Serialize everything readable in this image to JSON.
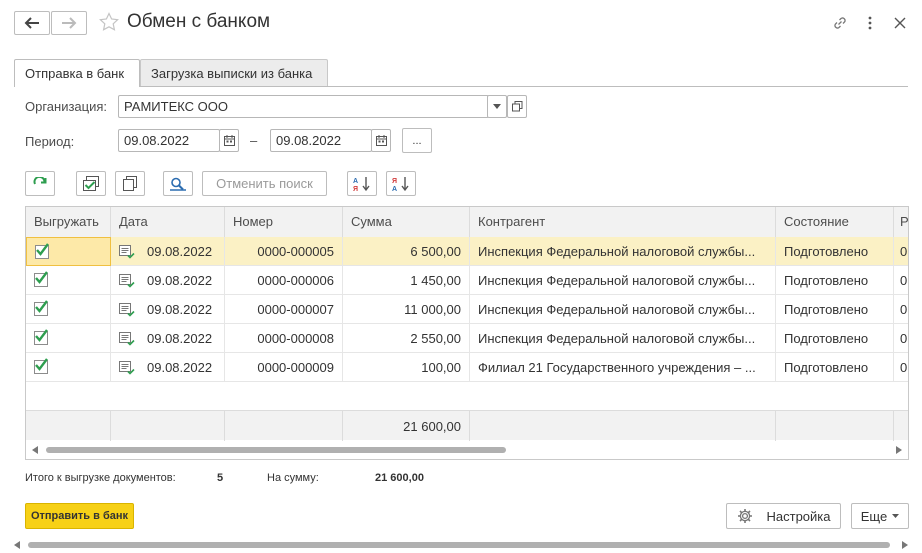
{
  "window": {
    "title": "Обмен с банком"
  },
  "tabs": [
    {
      "label": "Отправка в банк"
    },
    {
      "label": "Загрузка выписки из банка"
    }
  ],
  "form": {
    "org_label": "Организация:",
    "org_value": "РАМИТЕКС ООО",
    "period_label": "Период:",
    "period_from": "09.08.2022",
    "period_dash": "–",
    "period_to": "09.08.2022",
    "period_more": "..."
  },
  "toolbar": {
    "cancel_search": "Отменить поиск"
  },
  "table": {
    "headers": [
      "Выгружать",
      "Дата",
      "Номер",
      "Сумма",
      "Контрагент",
      "Состояние",
      "Р"
    ],
    "rows": [
      {
        "date": "09.08.2022",
        "number": "0000-000005",
        "sum": "6 500,00",
        "contractor": "Инспекция Федеральной налоговой службы...",
        "state": "Подготовлено",
        "extra": "0"
      },
      {
        "date": "09.08.2022",
        "number": "0000-000006",
        "sum": "1 450,00",
        "contractor": "Инспекция Федеральной налоговой службы...",
        "state": "Подготовлено",
        "extra": "0"
      },
      {
        "date": "09.08.2022",
        "number": "0000-000007",
        "sum": "11 000,00",
        "contractor": "Инспекция Федеральной налоговой службы...",
        "state": "Подготовлено",
        "extra": "0"
      },
      {
        "date": "09.08.2022",
        "number": "0000-000008",
        "sum": "2 550,00",
        "contractor": "Инспекция Федеральной налоговой службы...",
        "state": "Подготовлено",
        "extra": "0"
      },
      {
        "date": "09.08.2022",
        "number": "0000-000009",
        "sum": "100,00",
        "contractor": "Филиал 21 Государственного учреждения – ...",
        "state": "Подготовлено",
        "extra": "0"
      }
    ],
    "total": "21 600,00"
  },
  "summary": {
    "count_label": "Итого к выгрузке документов:",
    "count_value": "5",
    "sum_label": "На сумму:",
    "sum_value": "21 600,00"
  },
  "buttons": {
    "send": "Отправить в банк",
    "settings": "Настройка",
    "more": "Еще"
  },
  "colors": {
    "accent": "#f7d117",
    "selected_row": "#fbf1c5",
    "check": "#2e9e4f"
  }
}
